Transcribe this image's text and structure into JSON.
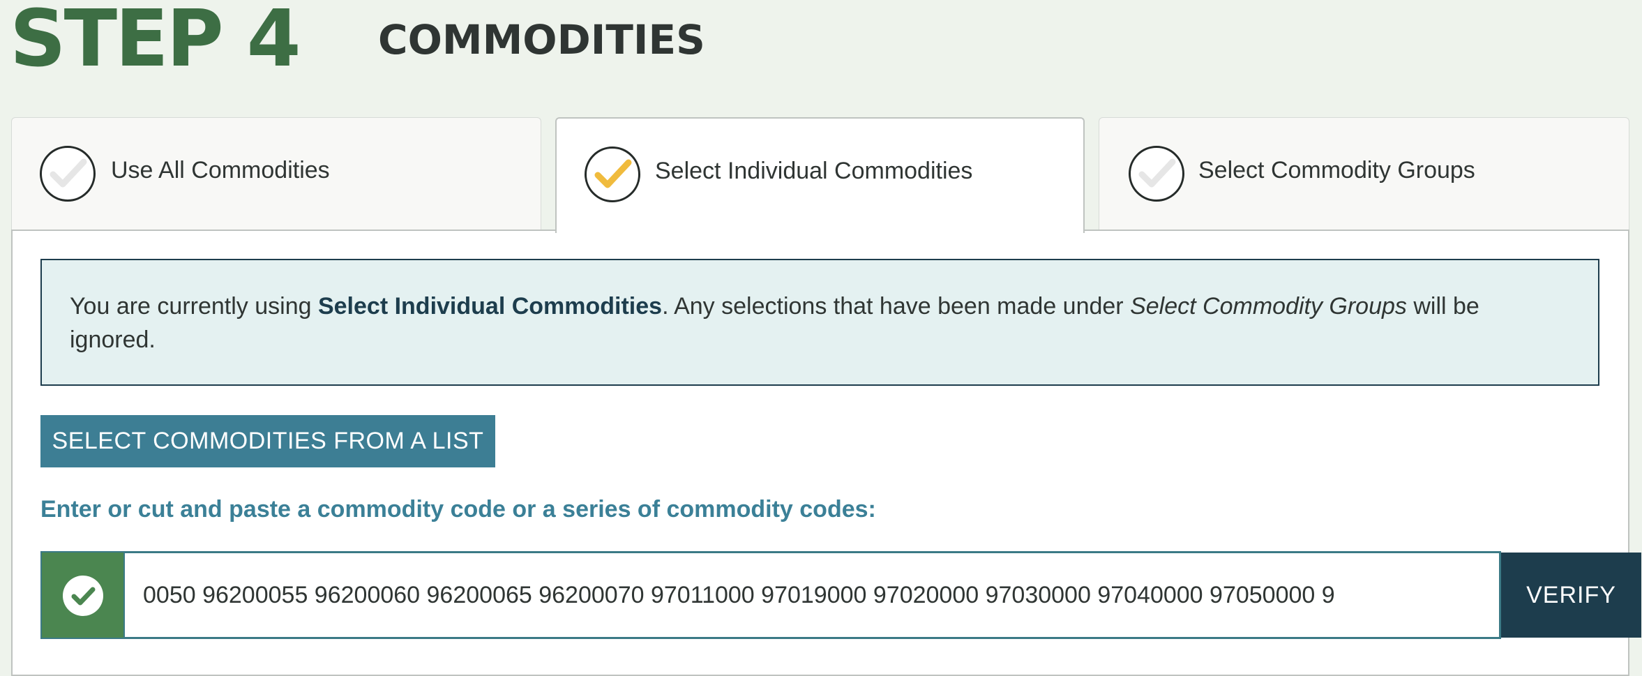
{
  "header": {
    "step": "STEP 4",
    "title": "COMMODITIES"
  },
  "tabs": [
    {
      "label": "Use All Commodities",
      "selected": false
    },
    {
      "label": "Select Individual Commodities",
      "selected": true
    },
    {
      "label": "Select Commodity Groups",
      "selected": false
    }
  ],
  "info": {
    "prefix": "You are currently using ",
    "current": "Select Individual Commodities",
    "middle": ". Any selections that have been made under ",
    "other": "Select Commodity Groups",
    "suffix": " will be ignored."
  },
  "buttons": {
    "select_list": "SELECT COMMODITIES FROM A LIST",
    "verify": "VERIFY"
  },
  "instructions": "Enter or cut and paste a commodity code or a series of commodity codes:",
  "codes_input": {
    "value": "0050 96200055 96200060 96200065 96200070 97011000 97019000 97020000 97030000 97040000 97050000 9"
  },
  "colors": {
    "green": "#3d6e44",
    "teal": "#3d7e94",
    "navy": "#1d3d4d",
    "check_selected": "#f0bb3d",
    "check_unselected": "#e6e6e6"
  }
}
